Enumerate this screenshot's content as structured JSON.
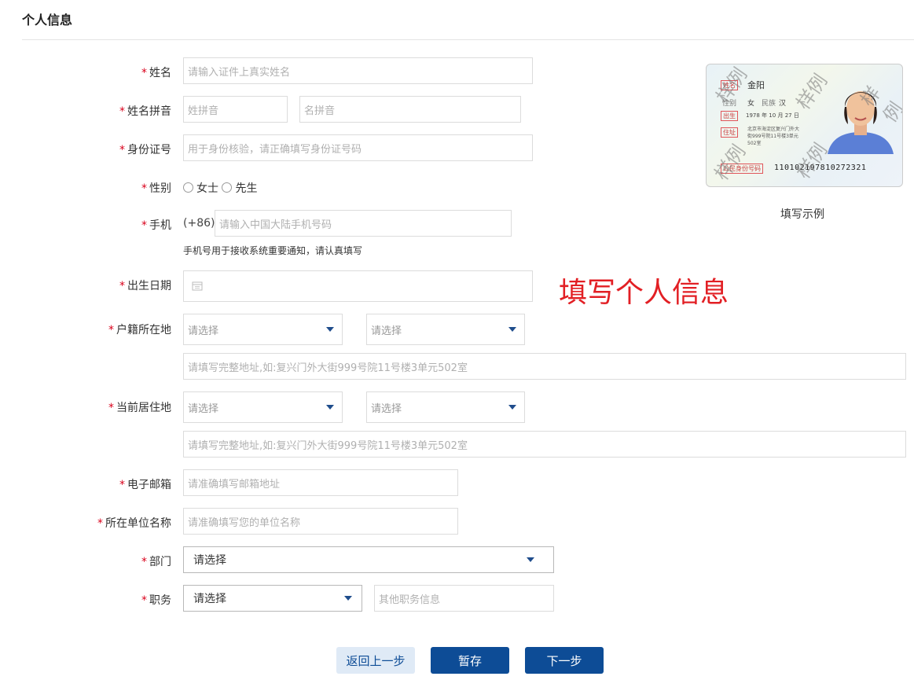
{
  "page": {
    "title": "个人信息"
  },
  "form": {
    "name": {
      "label": "*姓名",
      "placeholder": "请输入证件上真实姓名"
    },
    "pinyin": {
      "label": "*姓名拼音",
      "surname_placeholder": "姓拼音",
      "given_placeholder": "名拼音"
    },
    "id_number": {
      "label": "* 身份证号",
      "placeholder": "用于身份核验，请正确填写身份证号码"
    },
    "gender": {
      "label": "*性别",
      "options": [
        "女士",
        "先生"
      ]
    },
    "phone": {
      "label": "* 手机",
      "prefix": "(+86)",
      "placeholder": "请输入中国大陆手机号码",
      "hint": "手机号用于接收系统重要通知，请认真填写"
    },
    "birthdate": {
      "label": "* 出生日期"
    },
    "hukou": {
      "label": "* 户籍所在地",
      "select1": "请选择",
      "select2": "请选择",
      "address_placeholder": "请填写完整地址,如:复兴门外大街999号院11号楼3单元502室"
    },
    "residence": {
      "label": "* 当前居住地",
      "select1": "请选择",
      "select2": "请选择",
      "address_placeholder": "请填写完整地址,如:复兴门外大街999号院11号楼3单元502室"
    },
    "email": {
      "label": "* 电子邮箱",
      "placeholder": "请准确填写邮箱地址"
    },
    "company": {
      "label": "* 所在单位名称",
      "placeholder": "请准确填写您的单位名称"
    },
    "department": {
      "label": "* 部门",
      "value": "请选择"
    },
    "position": {
      "label": "* 职务",
      "value": "请选择",
      "other_placeholder": "其他职务信息"
    }
  },
  "annotation": {
    "text": "填写个人信息",
    "color": "#e21f24"
  },
  "example": {
    "caption": "填写示例",
    "watermark": "样例",
    "card": {
      "name_label": "姓名",
      "name": "金阳",
      "gender_label": "性别",
      "gender": "女",
      "ethnic_label": "民族",
      "ethnic": "汉",
      "birth_label": "出生",
      "birth_year": "1978",
      "year_unit": "年",
      "birth_month": "10",
      "month_unit": "月",
      "birth_day": "27",
      "day_unit": "日",
      "address_label": "住址",
      "address_line1": "北京市海淀区复兴门外大",
      "address_line2": "街999号院11号楼3单元",
      "address_line3": "502室",
      "id_label": "公民身份号码",
      "id_number": "110102197810272321"
    }
  },
  "buttons": {
    "back": "返回上一步",
    "save": "暂存",
    "next": "下一步"
  },
  "colors": {
    "primary": "#0d4c96",
    "required": "#d9001b",
    "back_bg": "#dfeaf6"
  }
}
